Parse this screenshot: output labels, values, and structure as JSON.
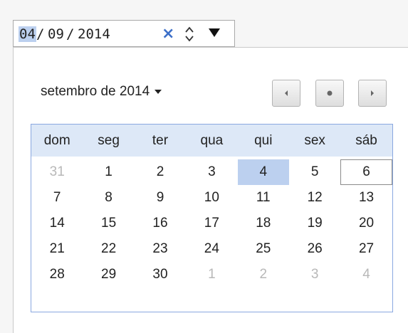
{
  "input": {
    "day": "04",
    "sep1": "/",
    "month": "09",
    "sep2": "/",
    "year": "2014",
    "clear_icon": "×"
  },
  "popup": {
    "month_label": "setembro de 2014",
    "weekdays": [
      "dom",
      "seg",
      "ter",
      "qua",
      "qui",
      "sex",
      "sáb"
    ],
    "weeks": [
      [
        "31",
        "1",
        "2",
        "3",
        "4",
        "5",
        "6"
      ],
      [
        "7",
        "8",
        "9",
        "10",
        "11",
        "12",
        "13"
      ],
      [
        "14",
        "15",
        "16",
        "17",
        "18",
        "19",
        "20"
      ],
      [
        "21",
        "22",
        "23",
        "24",
        "25",
        "26",
        "27"
      ],
      [
        "28",
        "29",
        "30",
        "1",
        "2",
        "3",
        "4"
      ]
    ],
    "other_month": [
      [
        true,
        false,
        false,
        false,
        false,
        false,
        false
      ],
      [
        false,
        false,
        false,
        false,
        false,
        false,
        false
      ],
      [
        false,
        false,
        false,
        false,
        false,
        false,
        false
      ],
      [
        false,
        false,
        false,
        false,
        false,
        false,
        false
      ],
      [
        false,
        false,
        false,
        true,
        true,
        true,
        true
      ]
    ],
    "selected_day": "4",
    "today_day": "6"
  },
  "icons": {
    "clear": "close-icon",
    "spin": "spin-up-down-icon",
    "dropdown": "triangle-down-icon",
    "month_menu": "caret-down-icon",
    "prev": "triangle-left-icon",
    "today": "dot-icon",
    "next": "triangle-right-icon"
  },
  "colors": {
    "selection": "#bcd0ef",
    "header_bg": "#dde8f7",
    "calendar_border": "#8aa8e0",
    "clear_icon": "#3c6fc8",
    "other_month_text": "#b8b8b8"
  }
}
